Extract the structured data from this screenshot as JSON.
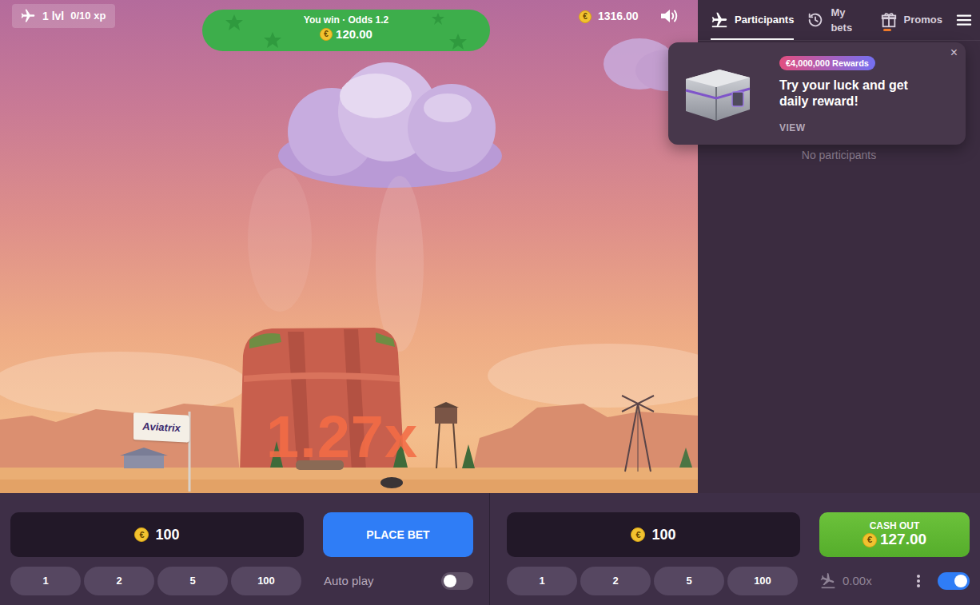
{
  "level": {
    "label": "1 lvl",
    "xp": "0/10 xp"
  },
  "win_toast": {
    "title": "You win · Odds 1.2",
    "amount": "120.00"
  },
  "currency": "€",
  "balance": "1316.00",
  "sound_on": true,
  "game": {
    "flag": "Aviatrix",
    "multiplier": "1.27x"
  },
  "sidebar": {
    "tabs": [
      {
        "label": "Participants",
        "selected": true,
        "notification": false
      },
      {
        "label": "My bets",
        "selected": false,
        "notification": false
      },
      {
        "label": "Promos",
        "selected": false,
        "notification": true
      }
    ],
    "empty_text": "No participants"
  },
  "promo_popup": {
    "badge": "€4,000,000 Rewards",
    "title": "Try your luck and get daily reward!",
    "action": "VIEW",
    "close": "×"
  },
  "bet_panels": [
    {
      "kind": "place",
      "amount": "100",
      "quick_amounts": [
        "1",
        "2",
        "5",
        "100"
      ],
      "button": {
        "label": "PLACE BET"
      },
      "auto_play": {
        "label": "Auto play",
        "on": false
      }
    },
    {
      "kind": "cashout",
      "amount": "100",
      "quick_amounts": [
        "1",
        "2",
        "5",
        "100"
      ],
      "button": {
        "label": "CASH OUT",
        "amount": "127.00"
      },
      "auto_cashout": {
        "value": "0.00x",
        "on": true
      }
    }
  ]
}
